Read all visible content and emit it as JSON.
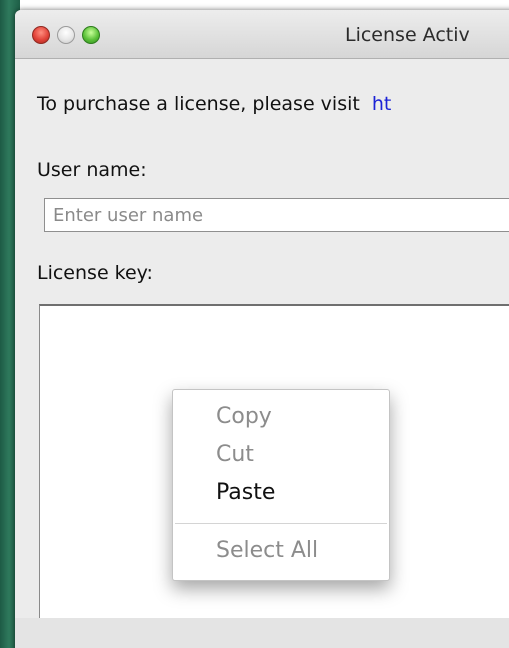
{
  "window": {
    "title": "License Activ"
  },
  "main": {
    "purchase_text": "To purchase a license, please visit",
    "purchase_link": "ht",
    "user_name_label": "User name:",
    "user_name_value": "",
    "user_name_placeholder": "Enter user name",
    "license_key_label": "License key:",
    "license_key_value": ""
  },
  "context_menu": {
    "items": [
      {
        "label": "Copy",
        "enabled": false
      },
      {
        "label": "Cut",
        "enabled": false
      },
      {
        "label": "Paste",
        "enabled": true
      },
      {
        "label": "Select All",
        "enabled": false
      }
    ]
  },
  "colors": {
    "link": "#1b22d6",
    "window_bg": "#ececec",
    "disabled_text": "#8c8c8c",
    "desktop_green": "#2f7a5d"
  }
}
